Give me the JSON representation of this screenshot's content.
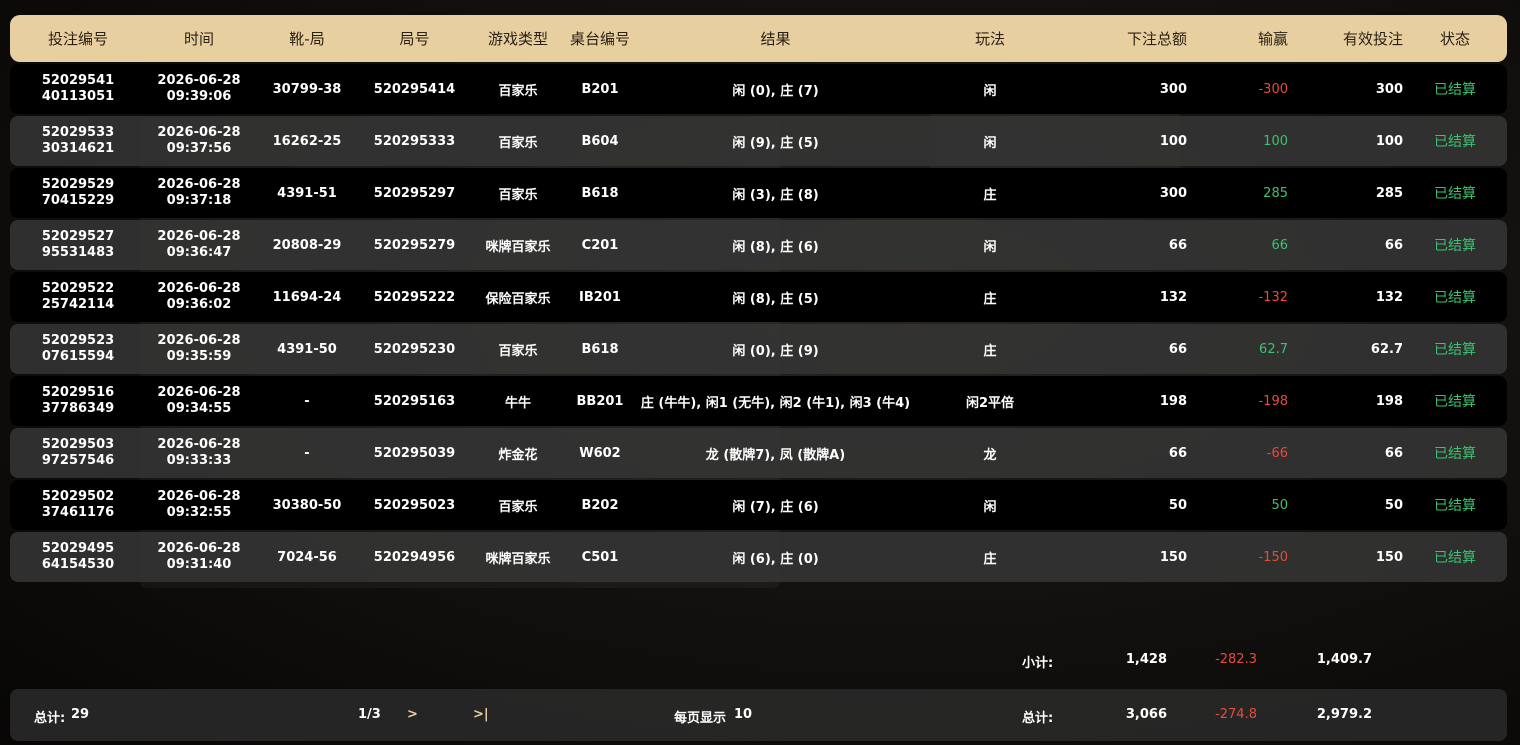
{
  "columns": {
    "bet_id": "投注编号",
    "time": "时间",
    "shoe_round": "靴-局",
    "round_no": "局号",
    "game_type": "游戏类型",
    "table_no": "桌台编号",
    "result": "结果",
    "play": "玩法",
    "bet_total": "下注总额",
    "win_loss": "输赢",
    "valid_bet": "有效投注",
    "status": "状态"
  },
  "rows": [
    {
      "id1": "52029541",
      "id2": "40113051",
      "date": "2026-06-28",
      "clock": "09:39:06",
      "shoe": "30799-38",
      "round": "520295414",
      "game": "百家乐",
      "table": "B201",
      "result": "闲 (0), 庄 (7)",
      "play": "闲",
      "bet": "300",
      "win": "-300",
      "win_sign": "neg",
      "valid": "300",
      "status": "已结算"
    },
    {
      "id1": "52029533",
      "id2": "30314621",
      "date": "2026-06-28",
      "clock": "09:37:56",
      "shoe": "16262-25",
      "round": "520295333",
      "game": "百家乐",
      "table": "B604",
      "result": "闲 (9), 庄 (5)",
      "play": "闲",
      "bet": "100",
      "win": "100",
      "win_sign": "pos",
      "valid": "100",
      "status": "已结算"
    },
    {
      "id1": "52029529",
      "id2": "70415229",
      "date": "2026-06-28",
      "clock": "09:37:18",
      "shoe": "4391-51",
      "round": "520295297",
      "game": "百家乐",
      "table": "B618",
      "result": "闲 (3), 庄 (8)",
      "play": "庄",
      "bet": "300",
      "win": "285",
      "win_sign": "pos",
      "valid": "285",
      "status": "已结算"
    },
    {
      "id1": "52029527",
      "id2": "95531483",
      "date": "2026-06-28",
      "clock": "09:36:47",
      "shoe": "20808-29",
      "round": "520295279",
      "game": "咪牌百家乐",
      "table": "C201",
      "result": "闲 (8), 庄 (6)",
      "play": "闲",
      "bet": "66",
      "win": "66",
      "win_sign": "pos",
      "valid": "66",
      "status": "已结算"
    },
    {
      "id1": "52029522",
      "id2": "25742114",
      "date": "2026-06-28",
      "clock": "09:36:02",
      "shoe": "11694-24",
      "round": "520295222",
      "game": "保险百家乐",
      "table": "IB201",
      "result": "闲 (8), 庄 (5)",
      "play": "庄",
      "bet": "132",
      "win": "-132",
      "win_sign": "neg",
      "valid": "132",
      "status": "已结算"
    },
    {
      "id1": "52029523",
      "id2": "07615594",
      "date": "2026-06-28",
      "clock": "09:35:59",
      "shoe": "4391-50",
      "round": "520295230",
      "game": "百家乐",
      "table": "B618",
      "result": "闲 (0), 庄 (9)",
      "play": "庄",
      "bet": "66",
      "win": "62.7",
      "win_sign": "pos",
      "valid": "62.7",
      "status": "已结算"
    },
    {
      "id1": "52029516",
      "id2": "37786349",
      "date": "2026-06-28",
      "clock": "09:34:55",
      "shoe": "-",
      "round": "520295163",
      "game": "牛牛",
      "table": "BB201",
      "result": "庄 (牛牛), 闲1 (无牛), 闲2 (牛1), 闲3 (牛4)",
      "play": "闲2平倍",
      "bet": "198",
      "win": "-198",
      "win_sign": "neg",
      "valid": "198",
      "status": "已结算"
    },
    {
      "id1": "52029503",
      "id2": "97257546",
      "date": "2026-06-28",
      "clock": "09:33:33",
      "shoe": "-",
      "round": "520295039",
      "game": "炸金花",
      "table": "W602",
      "result": "龙 (散牌7), 凤 (散牌A)",
      "play": "龙",
      "bet": "66",
      "win": "-66",
      "win_sign": "neg",
      "valid": "66",
      "status": "已结算"
    },
    {
      "id1": "52029502",
      "id2": "37461176",
      "date": "2026-06-28",
      "clock": "09:32:55",
      "shoe": "30380-50",
      "round": "520295023",
      "game": "百家乐",
      "table": "B202",
      "result": "闲 (7), 庄 (6)",
      "play": "闲",
      "bet": "50",
      "win": "50",
      "win_sign": "pos",
      "valid": "50",
      "status": "已结算"
    },
    {
      "id1": "52029495",
      "id2": "64154530",
      "date": "2026-06-28",
      "clock": "09:31:40",
      "shoe": "7024-56",
      "round": "520294956",
      "game": "咪牌百家乐",
      "table": "C501",
      "result": "闲 (6), 庄 (0)",
      "play": "庄",
      "bet": "150",
      "win": "-150",
      "win_sign": "neg",
      "valid": "150",
      "status": "已结算"
    }
  ],
  "subtotal": {
    "label": "小计:",
    "bet": "1,428",
    "win": "-282.3",
    "valid": "1,409.7"
  },
  "footer": {
    "count_label": "总计:",
    "count": "29",
    "page": "1/3",
    "next": ">",
    "last": ">|",
    "per_page_label": "每页显示",
    "per_page": "10",
    "total_label": "总计:",
    "bet": "3,066",
    "win": "-274.8",
    "valid": "2,979.2"
  },
  "colors": {
    "header_bg": "#e8cfa0",
    "negative": "#e54b3c",
    "positive": "#3cc270",
    "status": "#3cc270"
  }
}
